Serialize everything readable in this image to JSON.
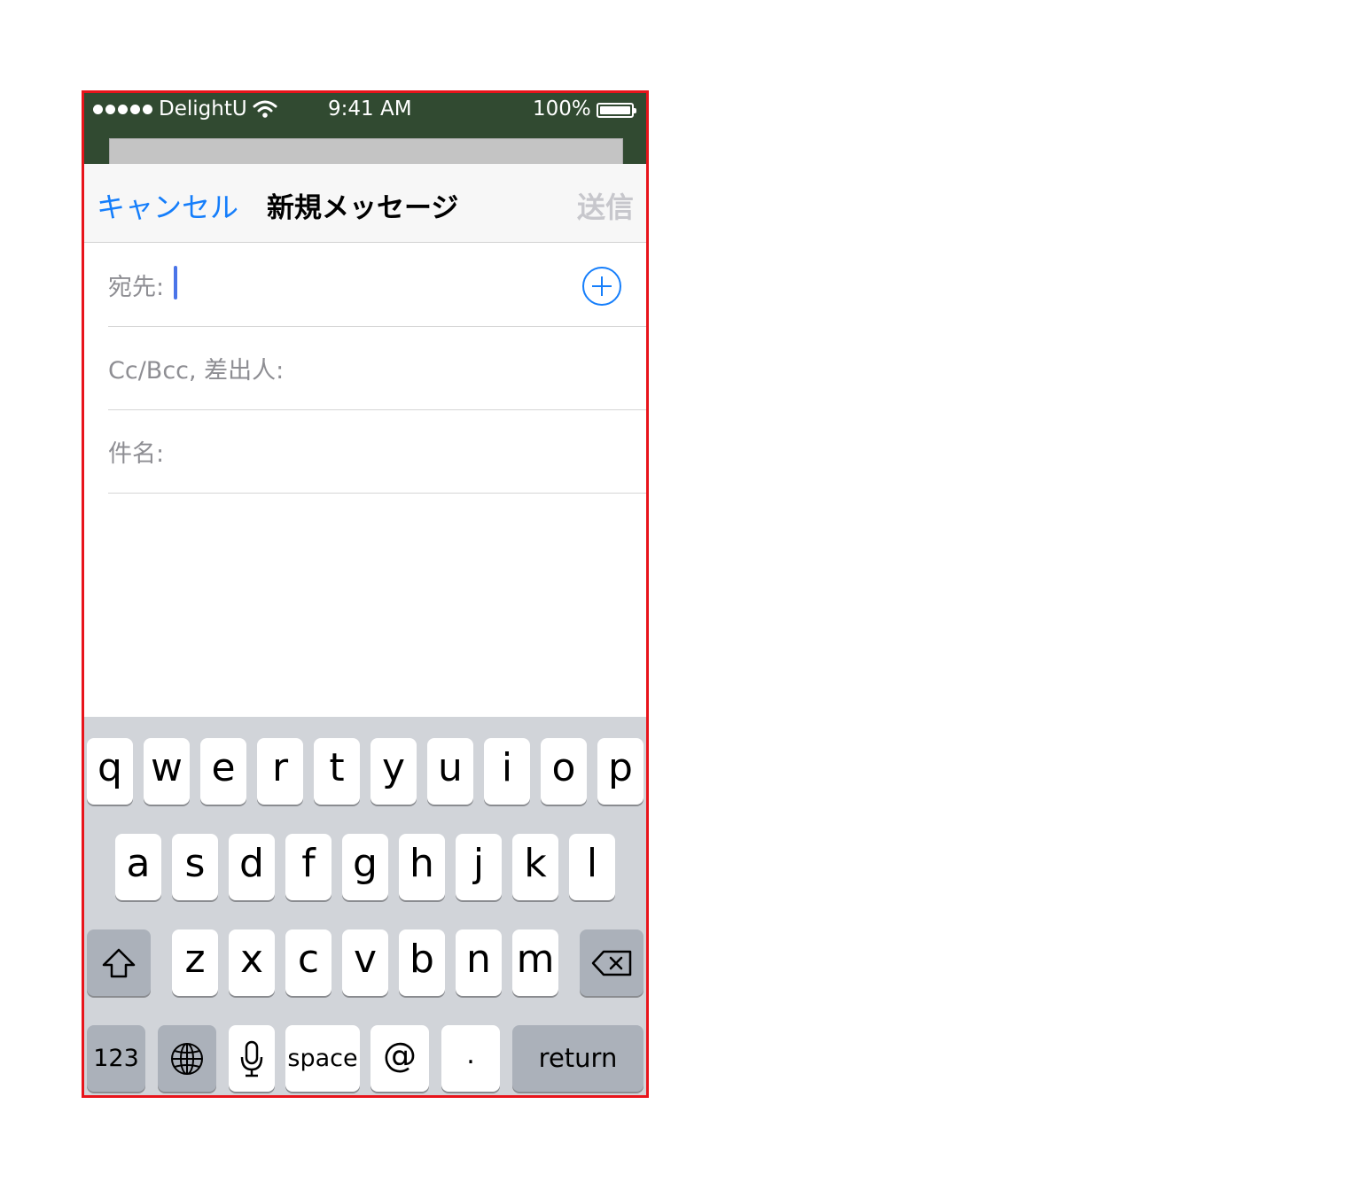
{
  "status_bar": {
    "carrier": "DelightU",
    "time": "9:41 AM",
    "battery": "100%"
  },
  "nav": {
    "cancel_label": "キャンセル",
    "title": "新規メッセージ",
    "send_label": "送信"
  },
  "form": {
    "to_label": "宛先:",
    "cc_label": "Cc/Bcc, 差出人:",
    "subject_label": "件名:"
  },
  "keyboard": {
    "row1": [
      "q",
      "w",
      "e",
      "r",
      "t",
      "y",
      "u",
      "i",
      "o",
      "p"
    ],
    "row2": [
      "a",
      "s",
      "d",
      "f",
      "g",
      "h",
      "j",
      "k",
      "l"
    ],
    "row3": [
      "z",
      "x",
      "c",
      "v",
      "b",
      "n",
      "m"
    ],
    "numbers_label": "123",
    "space_label": "space",
    "at_label": "@",
    "dot_label": ".",
    "return_label": "return"
  },
  "colors": {
    "accent": "#157efb",
    "frame_border": "#e8141b",
    "top_background": "#314a31",
    "keyboard_background": "#d1d4d9"
  },
  "icons": [
    "wifi-icon",
    "battery-icon",
    "add-contact-icon",
    "shift-icon",
    "backspace-icon",
    "globe-icon",
    "microphone-icon"
  ]
}
